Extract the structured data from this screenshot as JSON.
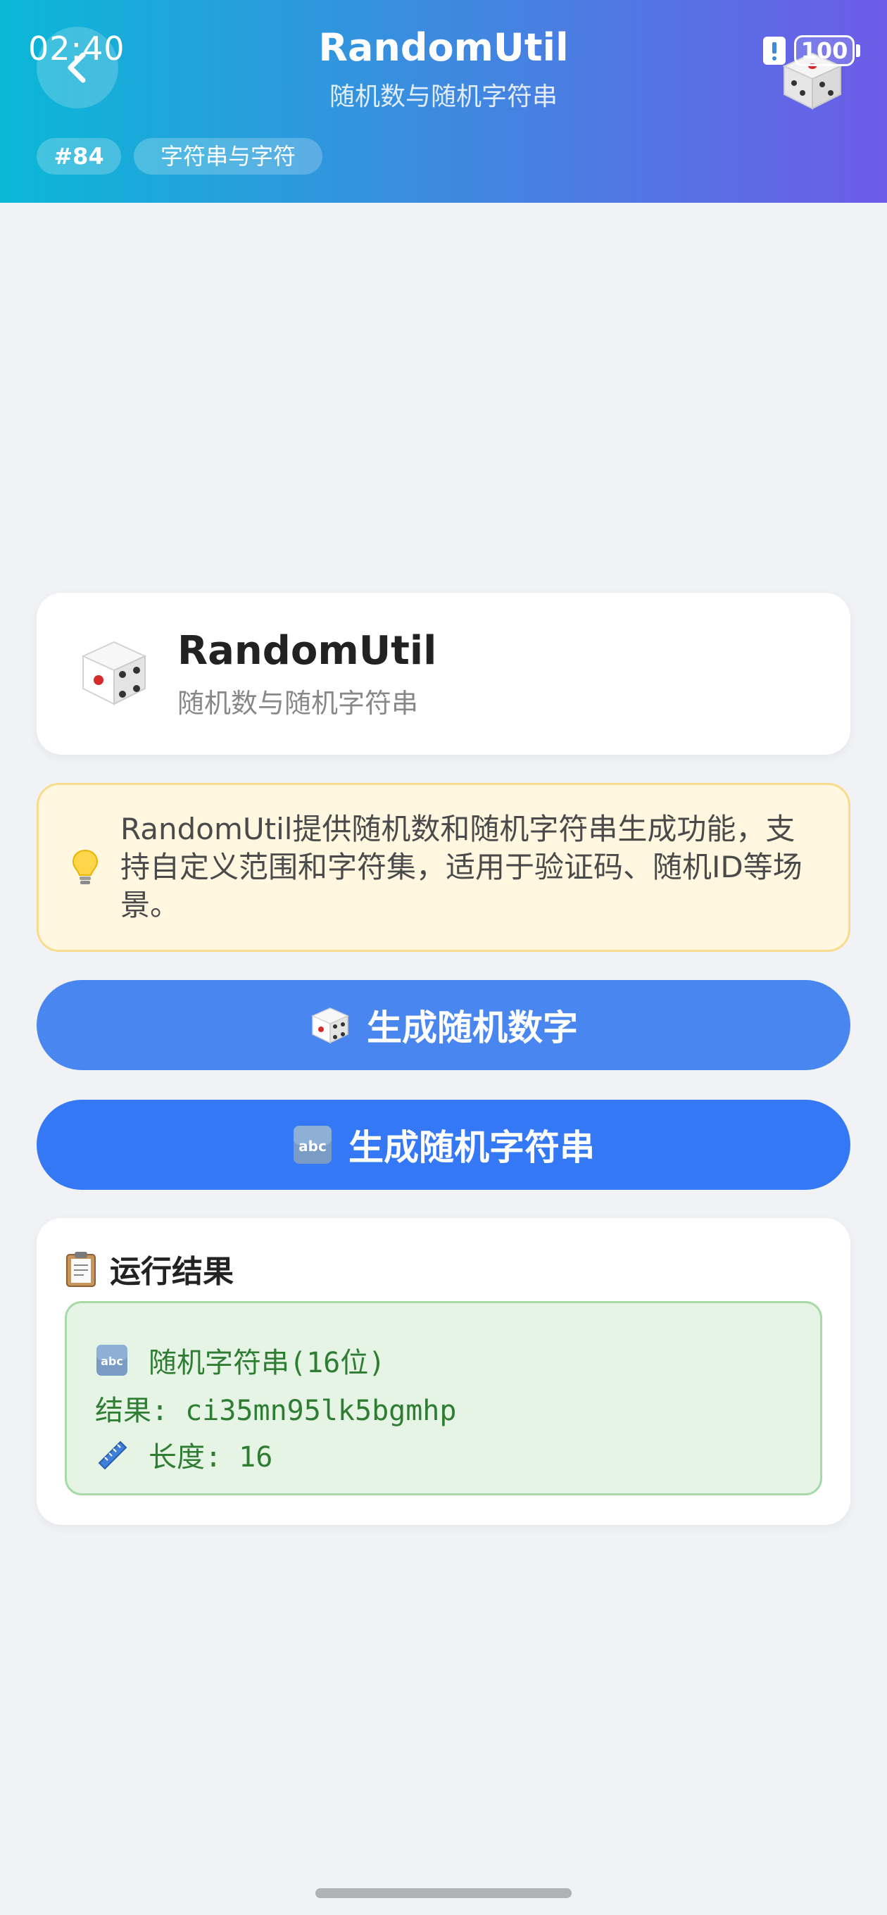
{
  "status_bar": {
    "time": "02:40",
    "battery": "100"
  },
  "header": {
    "title": "RandomUtil",
    "subtitle": "随机数与随机字符串",
    "tag_number": "#84",
    "tag_category": "字符串与字符"
  },
  "info_card": {
    "title": "RandomUtil",
    "subtitle": "随机数与随机字符串",
    "icon": "dice-icon"
  },
  "tip": {
    "icon": "lightbulb-icon",
    "text": "RandomUtil提供随机数和随机字符串生成功能，支持自定义范围和字符集，适用于验证码、随机ID等场景。"
  },
  "buttons": {
    "number_label": "生成随机数字",
    "number_icon": "dice-icon",
    "string_label": "生成随机字符串",
    "string_icon": "abc-icon"
  },
  "result": {
    "header_label": "运行结果",
    "header_icon": "clipboard-icon",
    "lines": {
      "type": "随机字符串(16位)",
      "value": "结果: ci35mn95lk5bgmhp",
      "length": "长度: 16"
    }
  },
  "colors": {
    "header_gradient_start": "#0ab8d6",
    "header_gradient_end": "#6c5ce7",
    "primary_button": "#3478f6",
    "result_text": "#2e7d32",
    "tip_background": "#fff7e0"
  }
}
